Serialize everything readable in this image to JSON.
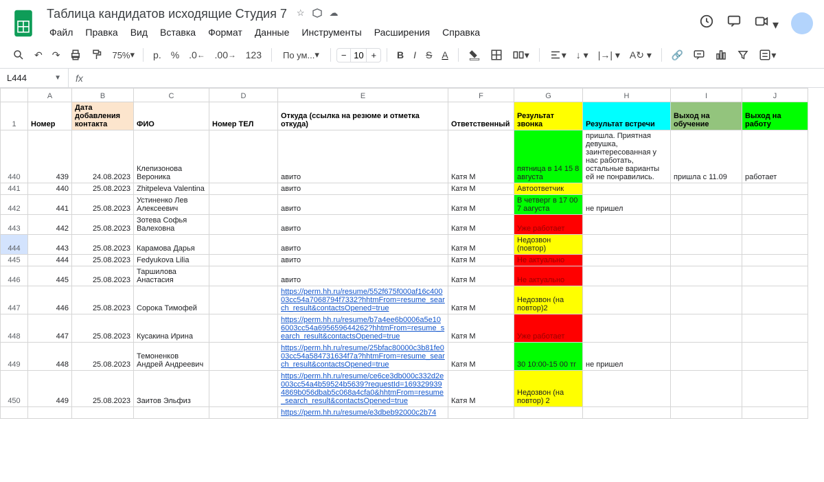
{
  "title": "Таблица кандидатов исходящие Студия 7",
  "menu": [
    "Файл",
    "Правка",
    "Вид",
    "Вставка",
    "Формат",
    "Данные",
    "Инструменты",
    "Расширения",
    "Справка"
  ],
  "toolbar": {
    "zoom": "75%",
    "currency": "р.",
    "percent": "%",
    "dec_dec": ".0",
    "dec_inc": ".00",
    "num123": "123",
    "font": "По ум...",
    "fontsize": "10",
    "minus": "−",
    "plus": "+"
  },
  "namebox": "L444",
  "fx": "fx",
  "cols": [
    "A",
    "B",
    "C",
    "D",
    "E",
    "F",
    "G",
    "H",
    "I",
    "J"
  ],
  "header_rownum": "1",
  "headers": {
    "A": "Номер",
    "B": "Дата добавления контакта",
    "C": "ФИО",
    "D": "Номер ТЕЛ",
    "E": "Откуда (ссылка на резюме и отметка откуда)",
    "F": "Ответственный",
    "G": "Результат звонка",
    "H": "Результат встречи",
    "I": "Выход на обучение",
    "J": "Выход на работу"
  },
  "rows": [
    {
      "rownum": "440",
      "A": "439",
      "B": "24.08.2023",
      "C": "Клепизонова Вероника",
      "E": "авито",
      "F": "Катя М",
      "G": "пятница в 14 15 8 августа",
      "Gcls": "c-green",
      "H": "пришла. Приятная девушка, заинтересованная у нас работать, остальные варианты ей не понравились.",
      "I": "пришла с 11.09",
      "J": "работает"
    },
    {
      "rownum": "441",
      "A": "440",
      "B": "25.08.2023",
      "C": "Zhitpeleva Valentina",
      "E": "авито",
      "F": "Катя М",
      "G": "Автоответчик",
      "Gcls": "c-yellow"
    },
    {
      "rownum": "442",
      "A": "441",
      "B": "25.08.2023",
      "C": "Устиненко Лев Алексеевич",
      "E": "авито",
      "F": "Катя М",
      "G": "В четверг в 17 00 7 аагуста",
      "Gcls": "c-green",
      "H": "не пришел"
    },
    {
      "rownum": "443",
      "A": "442",
      "B": "25.08.2023",
      "C": "Зотева Софья Валеховна",
      "E": "авито",
      "F": "Катя М",
      "G": "Уже работает",
      "Gcls": "c-red dark"
    },
    {
      "rownum": "444",
      "A": "443",
      "B": "25.08.2023",
      "C": "Карамова Дарья",
      "E": "авито",
      "F": "Катя М",
      "G": "Недозвон (повтор)",
      "Gcls": "c-yellow",
      "selected": true
    },
    {
      "rownum": "445",
      "A": "444",
      "B": "25.08.2023",
      "C": "Fedyukova Lilia",
      "E": "авито",
      "F": "Катя М",
      "G": "Не актуально",
      "Gcls": "c-red dark"
    },
    {
      "rownum": "446",
      "A": "445",
      "B": "25.08.2023",
      "C": "Таршилова Анастасия",
      "E": "авито",
      "F": "Катя М",
      "G": "Не актуально",
      "Gcls": "c-red dark"
    },
    {
      "rownum": "447",
      "A": "446",
      "B": "25.08.2023",
      "C": "Сорока Тимофей",
      "E": "https://perm.hh.ru/resume/552f675f000af16c40003cc54a7068794f7332?hhtmFrom=resume_search_result&contactsOpened=true",
      "Elink": true,
      "F": "Катя М",
      "G": "Недозвон (на повтор)2",
      "Gcls": "c-yellow"
    },
    {
      "rownum": "448",
      "A": "447",
      "B": "25.08.2023",
      "C": "Кусакина Ирина",
      "E": "https://perm.hh.ru/resume/b7a4ee6b0006a5e106003cc54a695659644262?hhtmFrom=resume_search_result&contactsOpened=true",
      "Elink": true,
      "F": "Катя М",
      "G": "Уже работает",
      "Gcls": "c-red dark"
    },
    {
      "rownum": "449",
      "A": "448",
      "B": "25.08.2023",
      "C": "Темоненков Андрей Андреевич",
      "E": "https://perm.hh.ru/resume/25bfac80000c3b81fe003cc54a584731634f7a?hhtmFrom=resume_search_result&contactsOpened=true",
      "Elink": true,
      "F": "Катя М",
      "G": "30 10:00-15 00 тг",
      "Gcls": "c-green",
      "H": "не пришел"
    },
    {
      "rownum": "450",
      "A": "449",
      "B": "25.08.2023",
      "C": "Заитов Эльфиз",
      "E": "https://perm.hh.ru/resume/ce6ce3db000c332d2e003cc54a4b59524b5639?requestId=1693299394869b056dbab5c068a4cfa0&hhtmFrom=resume_search_result&contactsOpened=true",
      "Elink": true,
      "F": "Катя М",
      "G": "Недозвон (на повтор) 2",
      "Gcls": "c-yellow"
    },
    {
      "rownum": "",
      "E": "https://perm.hh.ru/resume/e3dbeb92000c2b74",
      "Elink": true
    }
  ]
}
